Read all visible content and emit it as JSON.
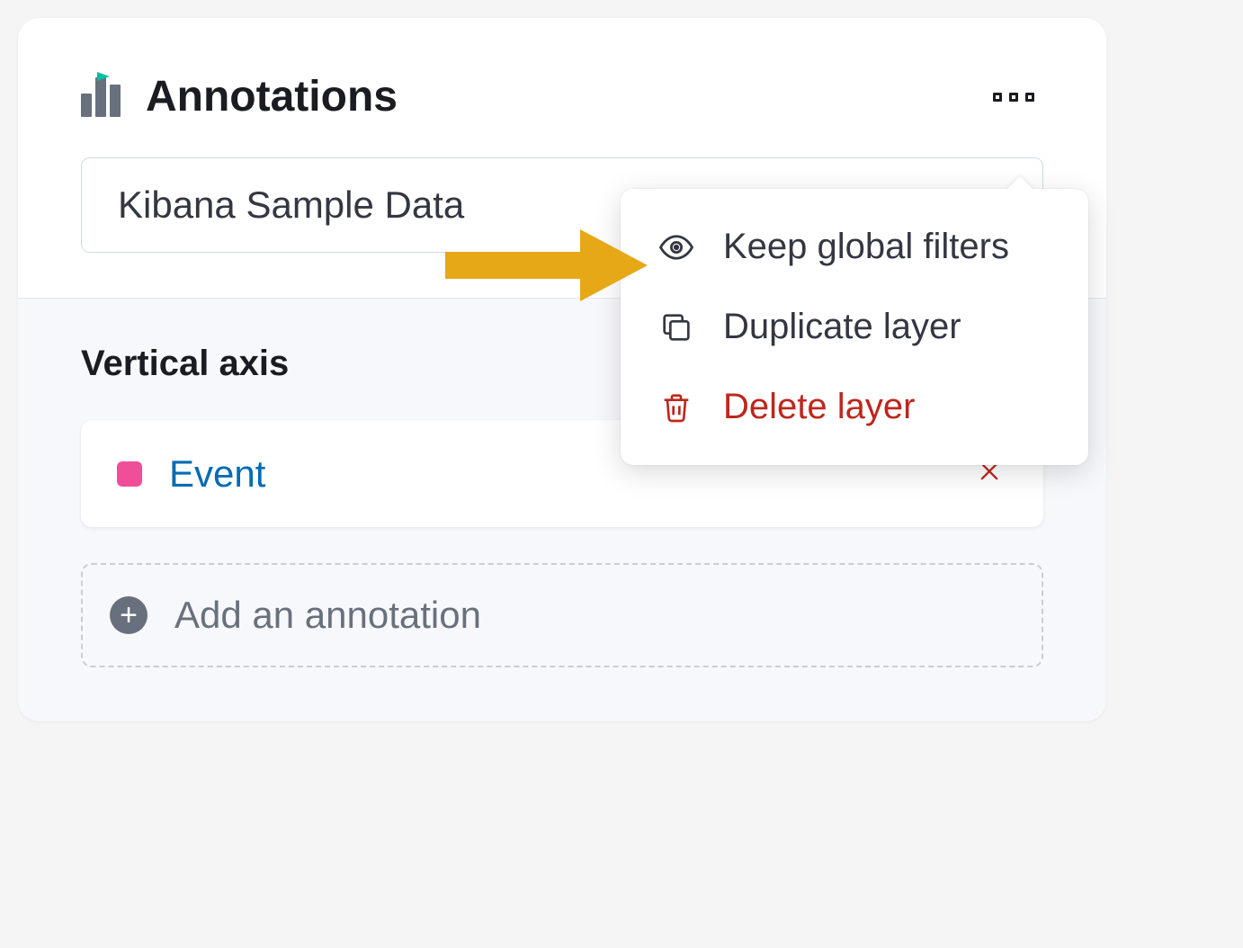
{
  "header": {
    "title": "Annotations"
  },
  "dataSource": {
    "value": "Kibana Sample Data"
  },
  "verticalAxis": {
    "label": "Vertical axis",
    "items": [
      {
        "label": "Event",
        "color": "#f04e98"
      }
    ],
    "addLabel": "Add an annotation"
  },
  "menu": {
    "keepGlobalFilters": "Keep global filters",
    "duplicateLayer": "Duplicate layer",
    "deleteLayer": "Delete layer"
  },
  "colors": {
    "danger": "#bd271e",
    "link": "#006bb4",
    "arrow": "#e6a817"
  }
}
